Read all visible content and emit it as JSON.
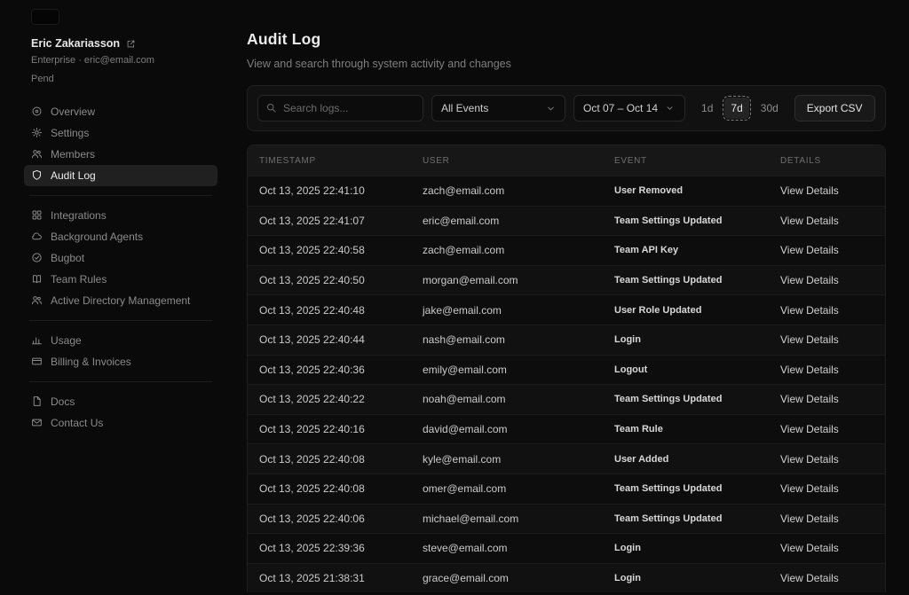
{
  "sidebar": {
    "user": {
      "name": "Eric Zakariasson",
      "meta_line1": "Enterprise · eric@email.com",
      "meta_line2": "Pend"
    },
    "sections": [
      {
        "items": [
          {
            "label": "Overview",
            "icon": "overview-icon",
            "active": false
          },
          {
            "label": "Settings",
            "icon": "settings-icon",
            "active": false
          },
          {
            "label": "Members",
            "icon": "members-icon",
            "active": false
          },
          {
            "label": "Audit Log",
            "icon": "audit-log-icon",
            "active": true
          }
        ]
      },
      {
        "items": [
          {
            "label": "Integrations",
            "icon": "integrations-icon",
            "active": false
          },
          {
            "label": "Background Agents",
            "icon": "background-agents-icon",
            "active": false
          },
          {
            "label": "Bugbot",
            "icon": "bugbot-icon",
            "active": false
          },
          {
            "label": "Team Rules",
            "icon": "team-rules-icon",
            "active": false
          },
          {
            "label": "Active Directory Management",
            "icon": "active-directory-icon",
            "active": false
          }
        ]
      },
      {
        "items": [
          {
            "label": "Usage",
            "icon": "usage-icon",
            "active": false
          },
          {
            "label": "Billing & Invoices",
            "icon": "billing-icon",
            "active": false
          }
        ]
      },
      {
        "items": [
          {
            "label": "Docs",
            "icon": "docs-icon",
            "active": false
          },
          {
            "label": "Contact Us",
            "icon": "contact-icon",
            "active": false
          }
        ]
      }
    ]
  },
  "header": {
    "title": "Audit Log",
    "subtitle": "View and search through system activity and changes"
  },
  "toolbar": {
    "search_placeholder": "Search logs...",
    "events_filter_value": "All Events",
    "date_range": "Oct 07 – Oct 14",
    "range_buttons": [
      "1d",
      "7d",
      "30d"
    ],
    "active_range": "7d",
    "export_label": "Export CSV"
  },
  "table": {
    "columns": [
      "TIMESTAMP",
      "USER",
      "EVENT",
      "DETAILS"
    ],
    "details_label": "View Details",
    "rows": [
      {
        "timestamp": "Oct 13, 2025 22:41:10",
        "user": "zach@email.com",
        "event": "User Removed"
      },
      {
        "timestamp": "Oct 13, 2025 22:41:07",
        "user": "eric@email.com",
        "event": "Team Settings Updated"
      },
      {
        "timestamp": "Oct 13, 2025 22:40:58",
        "user": "zach@email.com",
        "event": "Team API Key"
      },
      {
        "timestamp": "Oct 13, 2025 22:40:50",
        "user": "morgan@email.com",
        "event": "Team Settings Updated"
      },
      {
        "timestamp": "Oct 13, 2025 22:40:48",
        "user": "jake@email.com",
        "event": "User Role Updated"
      },
      {
        "timestamp": "Oct 13, 2025 22:40:44",
        "user": "nash@email.com",
        "event": "Login"
      },
      {
        "timestamp": "Oct 13, 2025 22:40:36",
        "user": "emily@email.com",
        "event": "Logout"
      },
      {
        "timestamp": "Oct 13, 2025 22:40:22",
        "user": "noah@email.com",
        "event": "Team Settings Updated"
      },
      {
        "timestamp": "Oct 13, 2025 22:40:16",
        "user": "david@email.com",
        "event": "Team Rule"
      },
      {
        "timestamp": "Oct 13, 2025 22:40:08",
        "user": "kyle@email.com",
        "event": "User Added"
      },
      {
        "timestamp": "Oct 13, 2025 22:40:08",
        "user": "omer@email.com",
        "event": "Team Settings Updated"
      },
      {
        "timestamp": "Oct 13, 2025 22:40:06",
        "user": "michael@email.com",
        "event": "Team Settings Updated"
      },
      {
        "timestamp": "Oct 13, 2025 22:39:36",
        "user": "steve@email.com",
        "event": "Login"
      },
      {
        "timestamp": "Oct 13, 2025 21:38:31",
        "user": "grace@email.com",
        "event": "Login"
      }
    ]
  },
  "colors": {
    "background": "#0a0a0a",
    "panel": "#111112",
    "active_item_bg": "#202020",
    "table_header_bg": "#171717",
    "border": "#212121",
    "text_primary": "#ececec",
    "text_muted": "#7f7f7f"
  }
}
